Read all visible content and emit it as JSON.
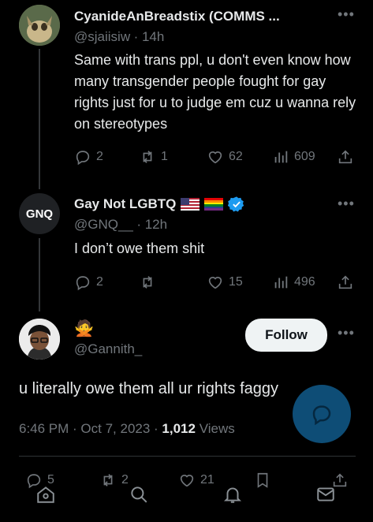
{
  "tweets": [
    {
      "name": "CyanideAnBreadstix (COMMS ...",
      "handle": "@sjaiisiw",
      "time": "· 14h",
      "text": "Same with trans ppl, u don't even know how many transgender people fought for gay rights just for u to judge em cuz u wanna rely on stereotypes",
      "replies": "2",
      "reposts": "1",
      "likes": "62",
      "views": "609"
    },
    {
      "name": "Gay Not LGBTQ",
      "avatar_text": "GNQ",
      "handle": "@GNQ__",
      "time": "· 12h",
      "text": "I don’t owe them shit",
      "replies": "2",
      "reposts": "",
      "likes": "15",
      "views": "496"
    }
  ],
  "main_tweet": {
    "name_emoji": "🙅",
    "handle": "@Gannith_",
    "follow_label": "Follow",
    "text": "u literally owe them all ur rights faggy",
    "timestamp": "6:46 PM · Oct 7, 2023 · ",
    "views_count": "1,012",
    "views_label": " Views"
  },
  "bottom_actions": {
    "replies": "5",
    "reposts": "2",
    "likes": "21"
  },
  "colors": {
    "background": "#000000",
    "text": "#e7e9ea",
    "muted": "#71767b",
    "accent": "#1d9bf0"
  },
  "icons": [
    "more-icon",
    "reply-icon",
    "repost-icon",
    "like-icon",
    "views-icon",
    "share-icon",
    "verified-icon",
    "bookmark-icon",
    "home-icon",
    "search-icon",
    "notifications-icon",
    "messages-icon",
    "compose-icon"
  ]
}
